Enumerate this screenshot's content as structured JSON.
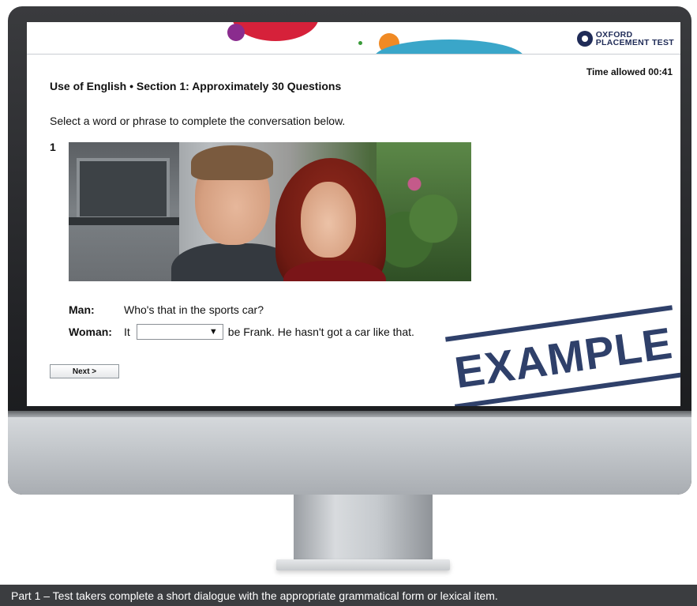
{
  "logo": {
    "line1": "OXFORD",
    "line2": "PLACEMENT TEST",
    "icon": "gear-logo-icon"
  },
  "timer": "Time allowed 00:41",
  "section_title": "Use of English • Section 1: Approximately 30 Questions",
  "instruction": "Select a word or phrase to complete the conversation below.",
  "question_number": "1",
  "dialogue": {
    "line1": {
      "speaker": "Man:",
      "text": "Who's that in the sports car?"
    },
    "line2": {
      "speaker": "Woman:",
      "before": "It",
      "select_value": "",
      "select_icon": "▼",
      "after": "be Frank. He hasn't got a car like that."
    }
  },
  "next_button": "Next >",
  "stamp": "EXAMPLE",
  "caption": "Part 1 – Test takers complete a short dialogue with the appropriate grammatical form or lexical item.",
  "colors": {
    "brand_navy": "#1f2b57",
    "stamp": "#20325f",
    "banner_red": "#d6213a",
    "banner_purple": "#8a2c8e",
    "banner_orange": "#f08a24",
    "banner_teal": "#3aa6c9",
    "caption_bg": "#3b3d40"
  }
}
